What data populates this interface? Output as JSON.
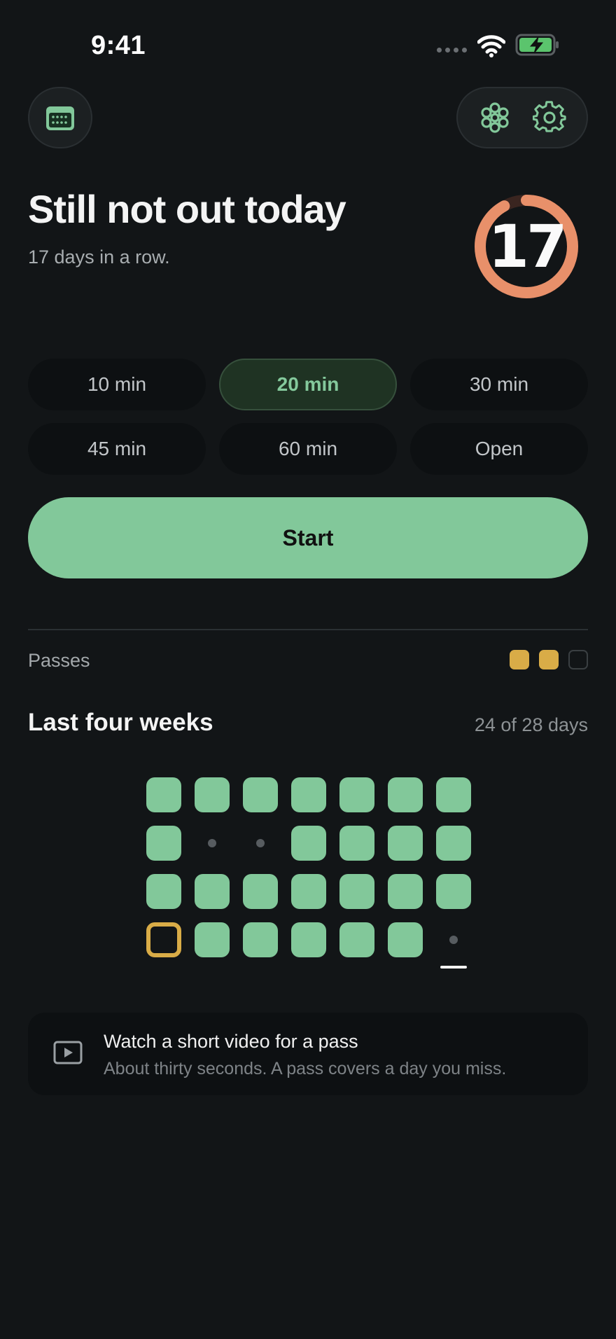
{
  "status": {
    "time": "9:41"
  },
  "header": {
    "calendar_icon": "calendar-icon",
    "flower_icon": "flower-icon",
    "settings_icon": "gear-icon"
  },
  "streak": {
    "title": "Still not out today",
    "subtitle": "17 days in a row.",
    "count": "17",
    "progress": 0.92
  },
  "durations": [
    {
      "label": "10 min",
      "selected": false
    },
    {
      "label": "20 min",
      "selected": true
    },
    {
      "label": "30 min",
      "selected": false
    },
    {
      "label": "45 min",
      "selected": false
    },
    {
      "label": "60 min",
      "selected": false
    },
    {
      "label": "Open",
      "selected": false
    }
  ],
  "start_label": "Start",
  "passes": {
    "label": "Passes",
    "states": [
      "full",
      "full",
      "empty"
    ]
  },
  "weeks": {
    "title": "Last four weeks",
    "count": "24 of 28 days",
    "grid": [
      [
        "done",
        "done",
        "done",
        "done",
        "done",
        "done",
        "done"
      ],
      [
        "done",
        "missed",
        "missed",
        "done",
        "done",
        "done",
        "done"
      ],
      [
        "done",
        "done",
        "done",
        "done",
        "done",
        "done",
        "done"
      ],
      [
        "pass-used",
        "done",
        "done",
        "done",
        "done",
        "done",
        "today"
      ]
    ]
  },
  "video": {
    "title": "Watch a short video for a pass",
    "subtitle": "About thirty seconds. A pass covers a day you miss.",
    "icon": "play-icon"
  },
  "colors": {
    "accent_green": "#82c89a",
    "streak_orange": "#e8906a",
    "pass_gold": "#d9ac47"
  }
}
